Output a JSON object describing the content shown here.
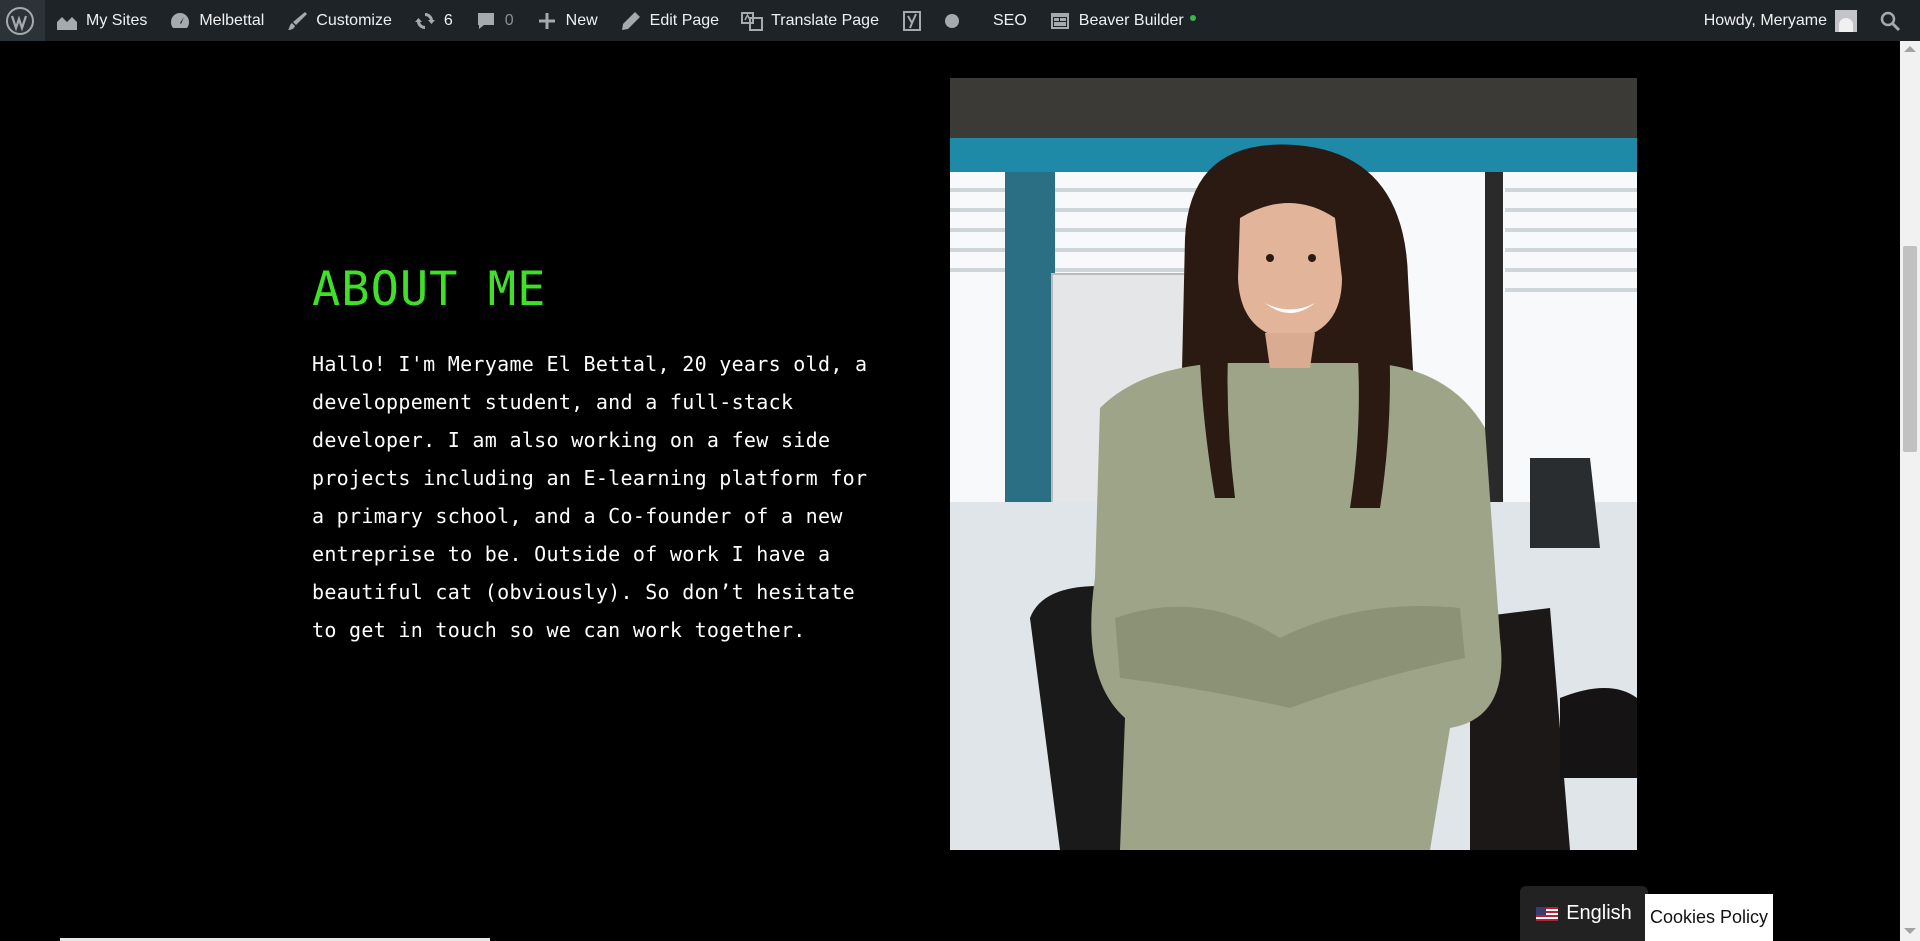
{
  "admin_bar": {
    "my_sites": "My Sites",
    "site_name": "Melbettal",
    "customize": "Customize",
    "updates_count": "6",
    "comments_count": "0",
    "new": "New",
    "edit_page": "Edit Page",
    "translate_page": "Translate Page",
    "seo": "SEO",
    "beaver_builder": "Beaver Builder",
    "howdy": "Howdy, Meryame"
  },
  "about": {
    "title": "ABOUT ME",
    "body": "Hallo! I'm Meryame El Bettal, 20 years old, a developpement student, and a full-stack developer. I am also working on a few side projects including an E-learning platform for a primary school, and a Co-founder of a new entreprise to be. Outside of work I have a beautiful cat (obviously). So don’t hesitate to get in touch so we can work together."
  },
  "language_switcher": {
    "label": "English"
  },
  "cookies": {
    "label": "Cookies Policy"
  },
  "colors": {
    "accent_green": "#3fe027",
    "admin_bar_bg": "#1d2327",
    "page_bg": "#000000"
  }
}
